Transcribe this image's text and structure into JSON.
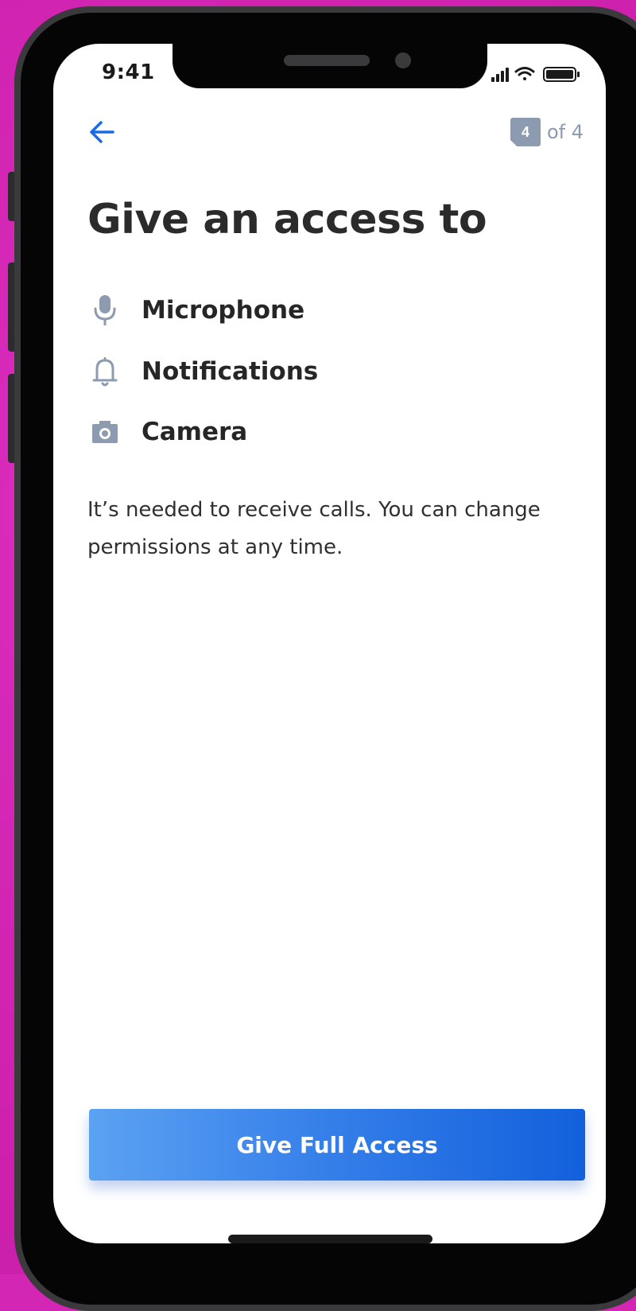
{
  "status_bar": {
    "time": "9:41",
    "icons": [
      "signal-icon",
      "wifi-icon",
      "battery-icon"
    ]
  },
  "header": {
    "back_icon": "arrow-left-icon",
    "step_current": "4",
    "step_total_text": "of 4"
  },
  "title": "Give an access to",
  "permissions": [
    {
      "icon": "microphone-icon",
      "label": "Microphone"
    },
    {
      "icon": "bell-icon",
      "label": "Notifications"
    },
    {
      "icon": "camera-icon",
      "label": "Camera"
    }
  ],
  "description": "It’s needed to receive calls. You can change permissions at any time.",
  "primary_button": {
    "label": "Give Full Access"
  },
  "colors": {
    "background": "#d426b4",
    "accent": "#1a6ae6",
    "icon_gray": "#8c9bb0",
    "text_dark": "#2b2b2b"
  }
}
